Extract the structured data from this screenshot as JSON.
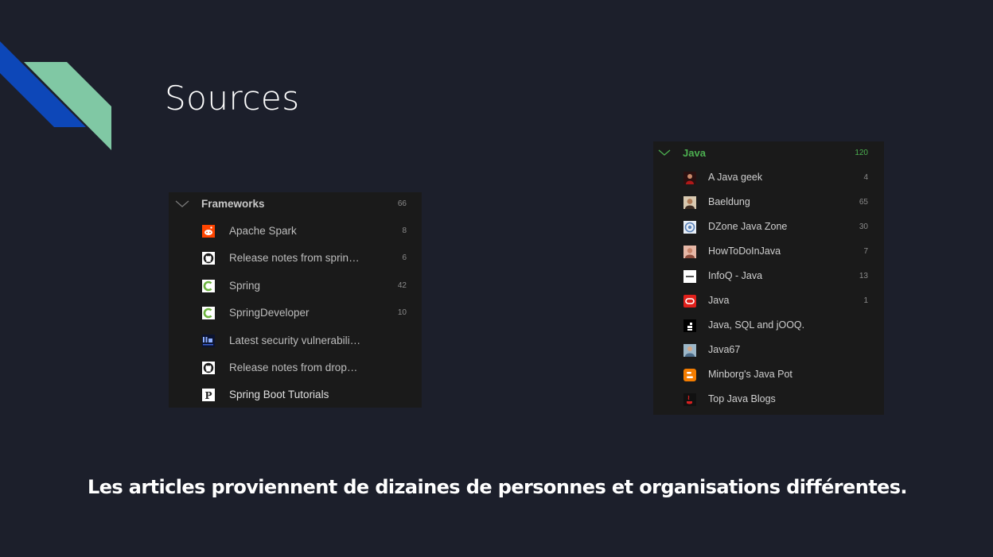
{
  "slide": {
    "title": "Sources",
    "caption": "Les articles proviennent de dizaines de personnes et organisations différentes."
  },
  "colors": {
    "background": "#1c1f2b",
    "deco_blue": "#0d47b8",
    "deco_green": "#80c8a4",
    "java_accent": "#4caf50"
  },
  "frameworks": {
    "title": "Frameworks",
    "count": "66",
    "items": [
      {
        "label": "Apache Spark",
        "count": "8",
        "icon": "reddit-icon"
      },
      {
        "label": "Release notes from sprin…",
        "count": "6",
        "icon": "github-icon"
      },
      {
        "label": "Spring",
        "count": "42",
        "icon": "spring-icon"
      },
      {
        "label": "SpringDeveloper",
        "count": "10",
        "icon": "spring-icon"
      },
      {
        "label": "Latest security vulnerabili…",
        "count": "",
        "icon": "security-site-icon"
      },
      {
        "label": "Release notes from drop…",
        "count": "",
        "icon": "github-icon"
      },
      {
        "label": "Spring Boot Tutorials",
        "count": "",
        "icon": "p-letter-icon"
      }
    ]
  },
  "java": {
    "title": "Java",
    "count": "120",
    "items": [
      {
        "label": "A Java geek",
        "count": "4",
        "icon": "person-icon"
      },
      {
        "label": "Baeldung",
        "count": "65",
        "icon": "person-icon"
      },
      {
        "label": "DZone Java Zone",
        "count": "30",
        "icon": "dzone-icon"
      },
      {
        "label": "HowToDoInJava",
        "count": "7",
        "icon": "person-icon"
      },
      {
        "label": "InfoQ - Java",
        "count": "13",
        "icon": "infoq-icon"
      },
      {
        "label": "Java",
        "count": "1",
        "icon": "oracle-icon"
      },
      {
        "label": "Java, SQL and jOOQ.",
        "count": "",
        "icon": "jooq-icon"
      },
      {
        "label": "Java67",
        "count": "",
        "icon": "person-icon"
      },
      {
        "label": "Minborg's Java Pot",
        "count": "",
        "icon": "blogger-icon"
      },
      {
        "label": "Top Java Blogs",
        "count": "",
        "icon": "java-logo-icon"
      }
    ]
  }
}
